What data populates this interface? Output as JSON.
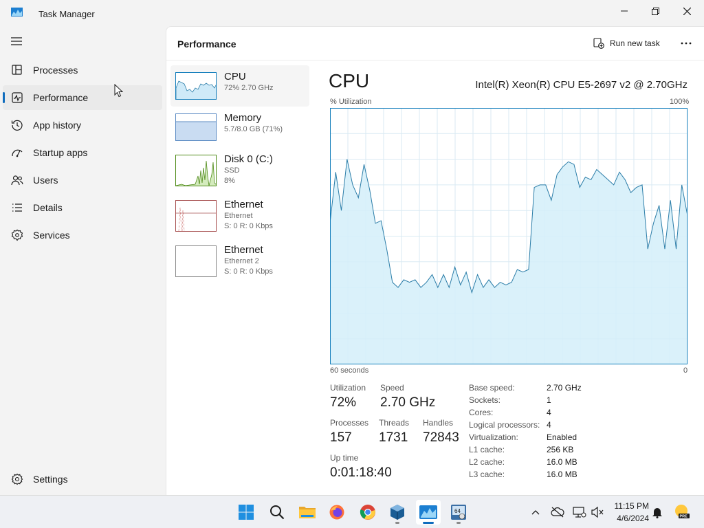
{
  "window": {
    "title": "Task Manager"
  },
  "nav": {
    "items": [
      {
        "label": "Processes",
        "icon": "processes-icon"
      },
      {
        "label": "Performance",
        "icon": "performance-icon",
        "active": true
      },
      {
        "label": "App history",
        "icon": "app-history-icon"
      },
      {
        "label": "Startup apps",
        "icon": "startup-apps-icon"
      },
      {
        "label": "Users",
        "icon": "users-icon"
      },
      {
        "label": "Details",
        "icon": "details-icon"
      },
      {
        "label": "Services",
        "icon": "services-icon"
      }
    ],
    "settings_label": "Settings"
  },
  "header": {
    "title": "Performance",
    "run_new_task": "Run new task"
  },
  "resources": [
    {
      "name": "CPU",
      "sub1": "72% 2.70 GHz",
      "sub2": ""
    },
    {
      "name": "Memory",
      "sub1": "5.7/8.0 GB (71%)",
      "sub2": ""
    },
    {
      "name": "Disk 0 (C:)",
      "sub1": "SSD",
      "sub2": "8%"
    },
    {
      "name": "Ethernet",
      "sub1": "Ethernet",
      "sub2": "S: 0 R: 0 Kbps"
    },
    {
      "name": "Ethernet",
      "sub1": "Ethernet 2",
      "sub2": "S: 0 R: 0 Kbps"
    }
  ],
  "detail": {
    "title": "CPU",
    "model": "Intel(R) Xeon(R) CPU E5-2697 v2 @ 2.70GHz",
    "y_label": "% Utilization",
    "y_max_label": "100%",
    "x_left_label": "60 seconds",
    "x_right_label": "0",
    "stats": {
      "utilization_label": "Utilization",
      "utilization": "72%",
      "speed_label": "Speed",
      "speed": "2.70 GHz",
      "processes_label": "Processes",
      "processes": "157",
      "threads_label": "Threads",
      "threads": "1731",
      "handles_label": "Handles",
      "handles": "72843",
      "uptime_label": "Up time",
      "uptime": "0:01:18:40"
    },
    "specs": [
      {
        "key": "Base speed:",
        "value": "2.70 GHz"
      },
      {
        "key": "Sockets:",
        "value": "1"
      },
      {
        "key": "Cores:",
        "value": "4"
      },
      {
        "key": "Logical processors:",
        "value": "4"
      },
      {
        "key": "Virtualization:",
        "value": "Enabled"
      },
      {
        "key": "L1 cache:",
        "value": "256 KB"
      },
      {
        "key": "L2 cache:",
        "value": "16.0 MB"
      },
      {
        "key": "L3 cache:",
        "value": "16.0 MB"
      }
    ],
    "utilization_history": [
      55,
      75,
      60,
      80,
      70,
      65,
      78,
      68,
      55,
      56,
      45,
      32,
      30,
      33,
      32,
      33,
      30,
      32,
      35,
      30,
      35,
      30,
      38,
      31,
      36,
      28,
      35,
      30,
      33,
      30,
      32,
      31,
      32,
      37,
      36,
      37,
      69,
      70,
      70,
      64,
      74,
      77,
      79,
      78,
      69,
      73,
      72,
      76,
      74,
      72,
      70,
      75,
      72,
      67,
      69,
      70,
      45,
      55,
      62,
      45,
      64,
      45,
      70,
      58
    ]
  },
  "taskbar": {
    "apps": [
      "start-icon",
      "search-icon",
      "file-explorer-icon",
      "firefox-icon",
      "chrome-icon",
      "virtualbox-icon",
      "task-manager-icon",
      "system-info-icon"
    ],
    "time": "11:15 PM",
    "date": "4/6/2024"
  },
  "colors": {
    "accent": "#0f6cbd",
    "graph_fill": "#d4eef9",
    "graph_line": "#2b7da8",
    "graph_border": "#117dbb",
    "grid": "#d9eaf3"
  }
}
